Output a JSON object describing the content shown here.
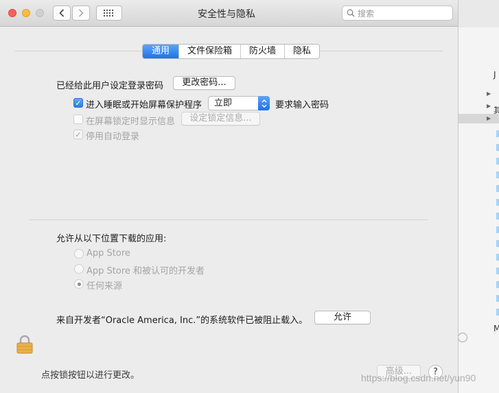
{
  "window": {
    "title": "安全性与隐私",
    "search_placeholder": "搜索"
  },
  "tabs": [
    {
      "label": "通用",
      "active": true
    },
    {
      "label": "文件保险箱",
      "active": false
    },
    {
      "label": "防火墙",
      "active": false
    },
    {
      "label": "隐私",
      "active": false
    }
  ],
  "general": {
    "password_set_label": "已经给此用户设定登录密码",
    "change_password_button": "更改密码...",
    "require_password": {
      "checked": true,
      "label_before": "进入睡眠或开始屏幕保护程序",
      "select_value": "立即",
      "label_after": "要求输入密码"
    },
    "lock_message": {
      "checked": false,
      "label": "在屏幕锁定时显示信息",
      "button": "设定锁定信息..."
    },
    "disable_auto_login": {
      "checked": true,
      "label": "停用自动登录"
    }
  },
  "downloads": {
    "heading": "允许从以下位置下载的应用:",
    "options": [
      {
        "label": "App Store",
        "selected": false
      },
      {
        "label": "App Store 和被认可的开发者",
        "selected": false
      },
      {
        "label": "任何来源",
        "selected": true
      }
    ],
    "blocked_message": "来自开发者“Oracle America, Inc.”的系统软件已被阻止载入。",
    "allow_button": "允许"
  },
  "footer": {
    "lock_text": "点按锁按钮以进行更改。",
    "advanced_button": "高级...",
    "help_label": "?"
  },
  "background_app": {
    "column_header": "J",
    "row_label": "其",
    "footer_label": "M"
  },
  "watermark": "https://blog.csdn.net/yun90",
  "colors": {
    "accent": "#1c74e6",
    "close": "#fc605b",
    "minimize": "#fdbc40"
  },
  "icons": [
    "lock-icon",
    "search-icon",
    "chevron-left-icon",
    "chevron-right-icon",
    "grid-icon",
    "checkmark-icon",
    "updown-arrows-icon"
  ]
}
